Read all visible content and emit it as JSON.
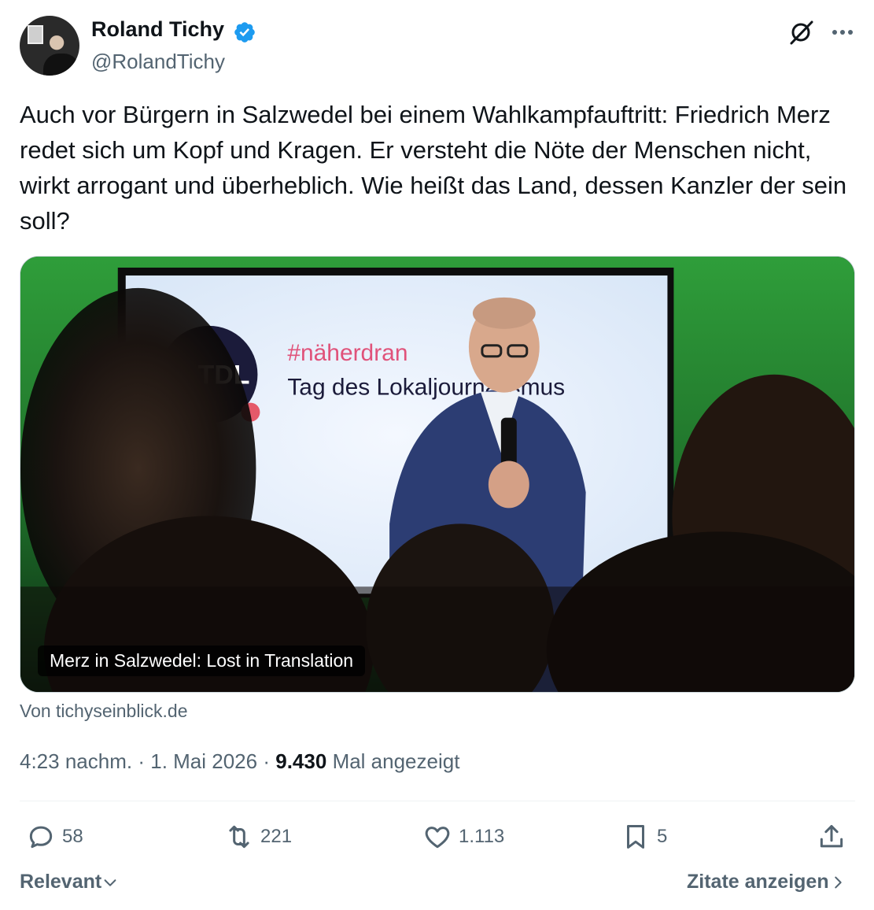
{
  "author": {
    "name": "Roland Tichy",
    "handle": "@RolandTichy"
  },
  "tweet": {
    "text": "Auch vor Bürgern in Salzwedel bei einem Wahlkampfauftritt: Friedrich Merz redet sich um Kopf und Kragen. Er versteht die Nöte der Menschen nicht, wirkt arrogant und überheblich. Wie heißt das Land, dessen Kanzler der sein soll?"
  },
  "card": {
    "title": "Merz in Salzwedel: Lost in Translation",
    "source": "Von tichyseinblick.de",
    "screen_hashtag": "#näherdran",
    "screen_subtitle": "Tag des Lokaljournalismus",
    "screen_logo": "TDL"
  },
  "meta": {
    "time": "4:23 nachm.",
    "date": "1. Mai 2026",
    "separator": "·",
    "views_count": "9.430",
    "views_label": "Mal angezeigt"
  },
  "actions": {
    "replies": "58",
    "reposts": "221",
    "likes": "1.113",
    "bookmarks": "5"
  },
  "footer": {
    "sort_label": "Relevant",
    "quotes_label": "Zitate anzeigen"
  },
  "colors": {
    "text_primary": "#0f1419",
    "text_secondary": "#536471",
    "verified": "#1d9bf0",
    "divider": "#eff3f4"
  }
}
